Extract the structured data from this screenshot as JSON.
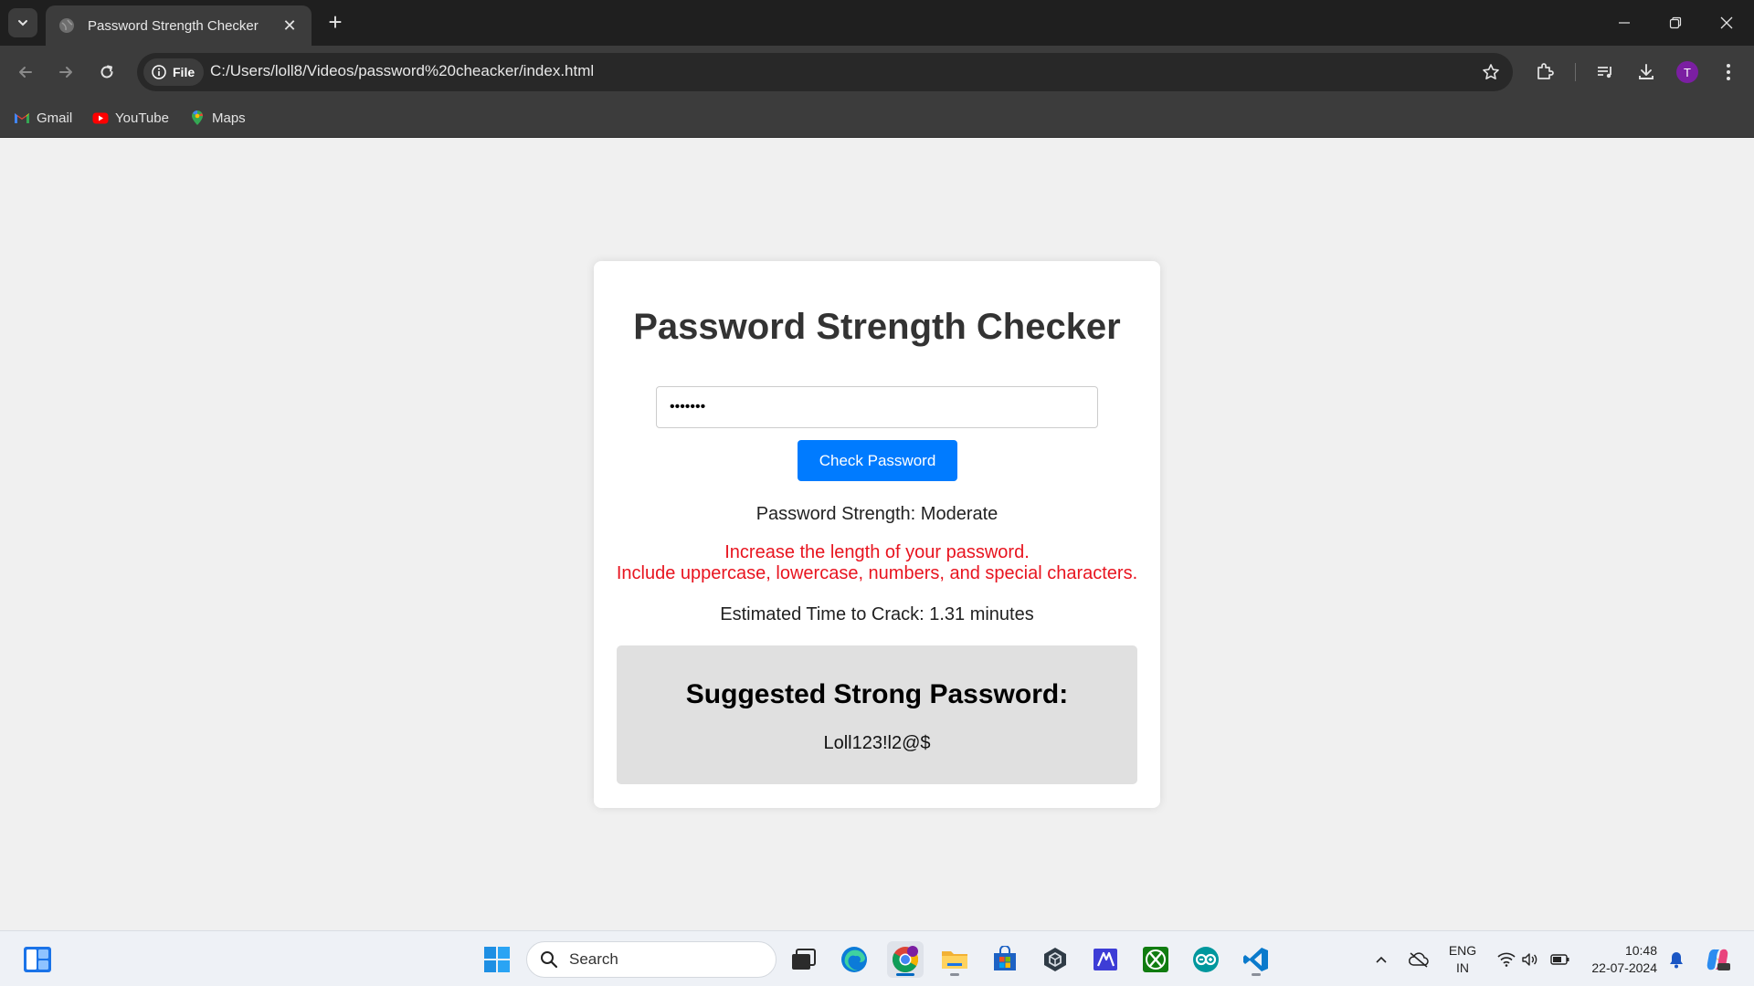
{
  "browser": {
    "tab_title": "Password Strength Checker",
    "new_tab_glyph": "+",
    "close_glyph": "✕",
    "omnibox": {
      "scheme_chip": "File",
      "url": "C:/Users/loll8/Videos/password%20cheacker/index.html"
    },
    "profile_initial": "T",
    "bookmarks": [
      {
        "label": "Gmail",
        "icon": "gmail-icon"
      },
      {
        "label": "YouTube",
        "icon": "youtube-icon"
      },
      {
        "label": "Maps",
        "icon": "maps-icon"
      }
    ]
  },
  "page": {
    "title": "Password Strength Checker",
    "password_value": "1234567",
    "check_button_label": "Check Password",
    "strength_text": "Password Strength: Moderate",
    "feedback": [
      "Increase the length of your password.",
      "Include uppercase, lowercase, numbers, and special characters."
    ],
    "crack_time_text": "Estimated Time to Crack: 1.31 minutes",
    "suggestion": {
      "heading": "Suggested Strong Password:",
      "value": "Loll123!l2@$"
    }
  },
  "taskbar": {
    "search_placeholder": "Search",
    "language": {
      "line1": "ENG",
      "line2": "IN"
    },
    "clock": {
      "time": "10:48",
      "date": "22-07-2024"
    },
    "apps": [
      "start-icon",
      "task-view-icon",
      "edge-icon",
      "chrome-icon",
      "file-explorer-icon",
      "microsoft-store-icon",
      "unity-icon",
      "visual-studio-icon",
      "xbox-icon",
      "arduino-icon",
      "vscode-icon"
    ]
  },
  "colors": {
    "accent_button": "#007bff",
    "feedback_text": "#e8141f",
    "suggestion_bg": "#e0e0e0",
    "browser_dark": "#3c3c3c"
  }
}
